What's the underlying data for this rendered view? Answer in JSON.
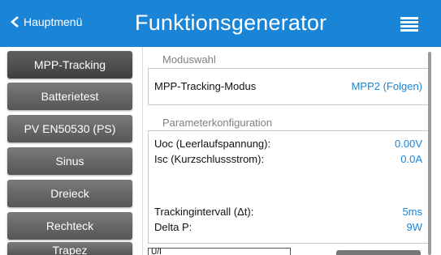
{
  "header": {
    "back_label": "Hauptmenü",
    "title": "Funktionsgenerator",
    "menu_icon": "hamburger-menu-icon",
    "back_icon": "chevron-left-icon",
    "accent_color": "#1a84d7"
  },
  "sidebar": {
    "items": [
      {
        "label": "MPP-Tracking"
      },
      {
        "label": "Batterietest"
      },
      {
        "label": "PV EN50530 (PS)"
      },
      {
        "label": "Sinus"
      },
      {
        "label": "Dreieck"
      },
      {
        "label": "Rechteck"
      },
      {
        "label": "Trapez"
      }
    ]
  },
  "mode": {
    "section_label": "Moduswahl",
    "label": "MPP-Tracking-Modus",
    "value": "MPP2 (Folgen)"
  },
  "params": {
    "section_label": "Parameterkonfiguration",
    "uoc_label": "Uoc (Leerlaufspannung):",
    "uoc_value": "0.00V",
    "isc_label": "Isc (Kurzschlussstrom):",
    "isc_value": "0.0A",
    "tracking_label": "Trackingintervall (Δt):",
    "tracking_value": "5ms",
    "delta_label": "Delta P:",
    "delta_value": "9W"
  },
  "bottom": {
    "field_value": "U/I"
  }
}
